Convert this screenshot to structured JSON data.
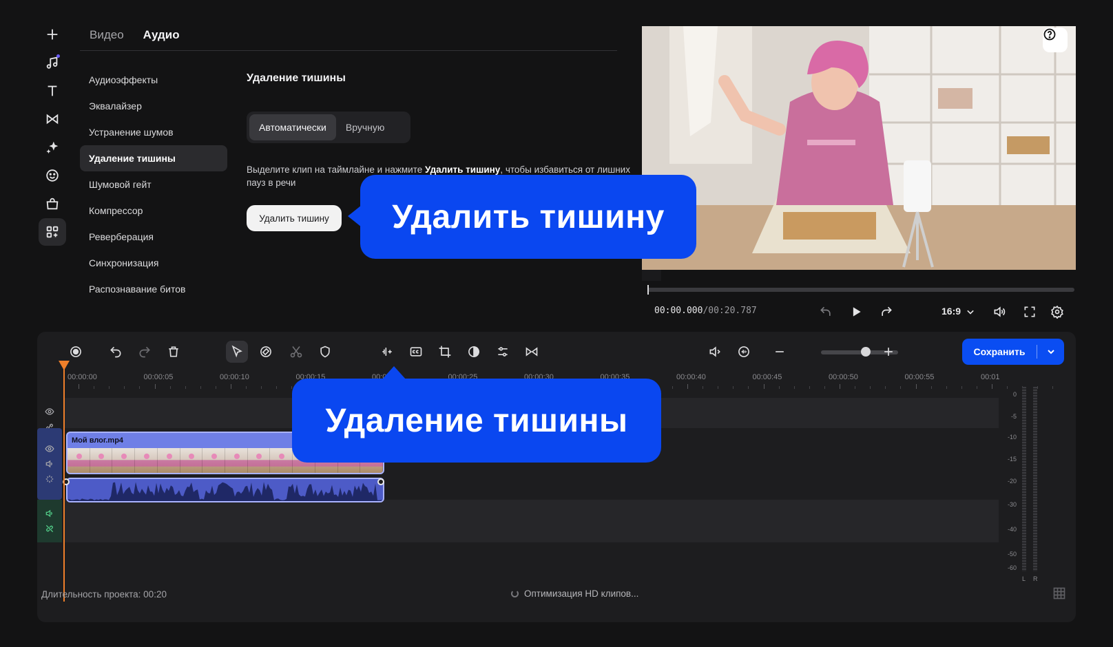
{
  "tabs": [
    {
      "label": "Видео",
      "active": false
    },
    {
      "label": "Аудио",
      "active": true
    }
  ],
  "rail_icons": [
    "plus-icon",
    "music-icon",
    "text-icon",
    "transitions-icon",
    "sparkle-icon",
    "sticker-icon",
    "store-icon",
    "apps-icon"
  ],
  "effects": [
    {
      "label": "Аудиоэффекты"
    },
    {
      "label": "Эквалайзер"
    },
    {
      "label": "Устранение шумов"
    },
    {
      "label": "Удаление тишины",
      "active": true
    },
    {
      "label": "Шумовой гейт"
    },
    {
      "label": "Компрессор"
    },
    {
      "label": "Реверберация"
    },
    {
      "label": "Синхронизация"
    },
    {
      "label": "Распознавание битов"
    }
  ],
  "panel": {
    "title": "Удаление тишины",
    "modes": [
      "Автоматически",
      "Вручную"
    ],
    "active_mode": "Автоматически",
    "desc_before": "Выделите клип на таймлайне и нажмите ",
    "desc_bold": "Удалить тишину",
    "desc_after": ", чтобы избавиться от лишних пауз в речи",
    "button": "Удалить тишину"
  },
  "preview": {
    "time_current": "00:00.000",
    "time_total": "/00:20.787",
    "aspect_ratio": "16:9"
  },
  "toolbar": {
    "save_label": "Сохранить",
    "zoom_level": 0.52
  },
  "ruler_labels": [
    "00:00:00",
    "00:00:05",
    "00:00:10",
    "00:00:15",
    "00:00:20",
    "00:00:25",
    "00:00:30",
    "00:00:35",
    "00:00:40",
    "00:00:45",
    "00:00:50",
    "00:00:55",
    "00:01"
  ],
  "clip": {
    "name": "Мой влог.mp4"
  },
  "meter": {
    "labels": [
      "0",
      "-5",
      "-10",
      "-15",
      "-20",
      "-30",
      "-40",
      "-50",
      "-60"
    ],
    "left": "L",
    "right": "R"
  },
  "status": {
    "duration": "Длительность проекта: 00:20",
    "optimizing": "Оптимизация HD клипов..."
  },
  "callouts": {
    "remove": "Удалить тишину",
    "silence": "Удаление тишины"
  },
  "colors": {
    "accent": "#0A47F0",
    "playhead": "#EF7F2A",
    "clip_video": "#6F7FE6",
    "clip_audio": "#4D5BC7"
  }
}
